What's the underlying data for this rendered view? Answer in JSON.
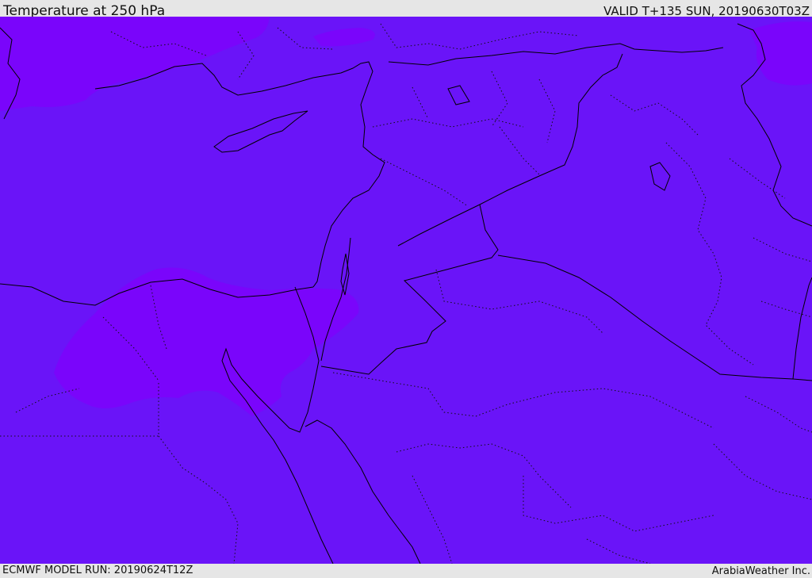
{
  "header": {
    "title": "Temperature at 250 hPa",
    "valid_time": "VALID T+135 SUN, 20190630T03Z"
  },
  "footer": {
    "model_run": "ECMWF MODEL RUN: 20190624T12Z",
    "credit": "ArabiaWeather Inc."
  },
  "map": {
    "field": "temperature-250hPa",
    "background_color": "#6a14f8",
    "warm_region_color": "#7a05fb",
    "coastline_color": "#000000",
    "border_style": "dotted"
  }
}
